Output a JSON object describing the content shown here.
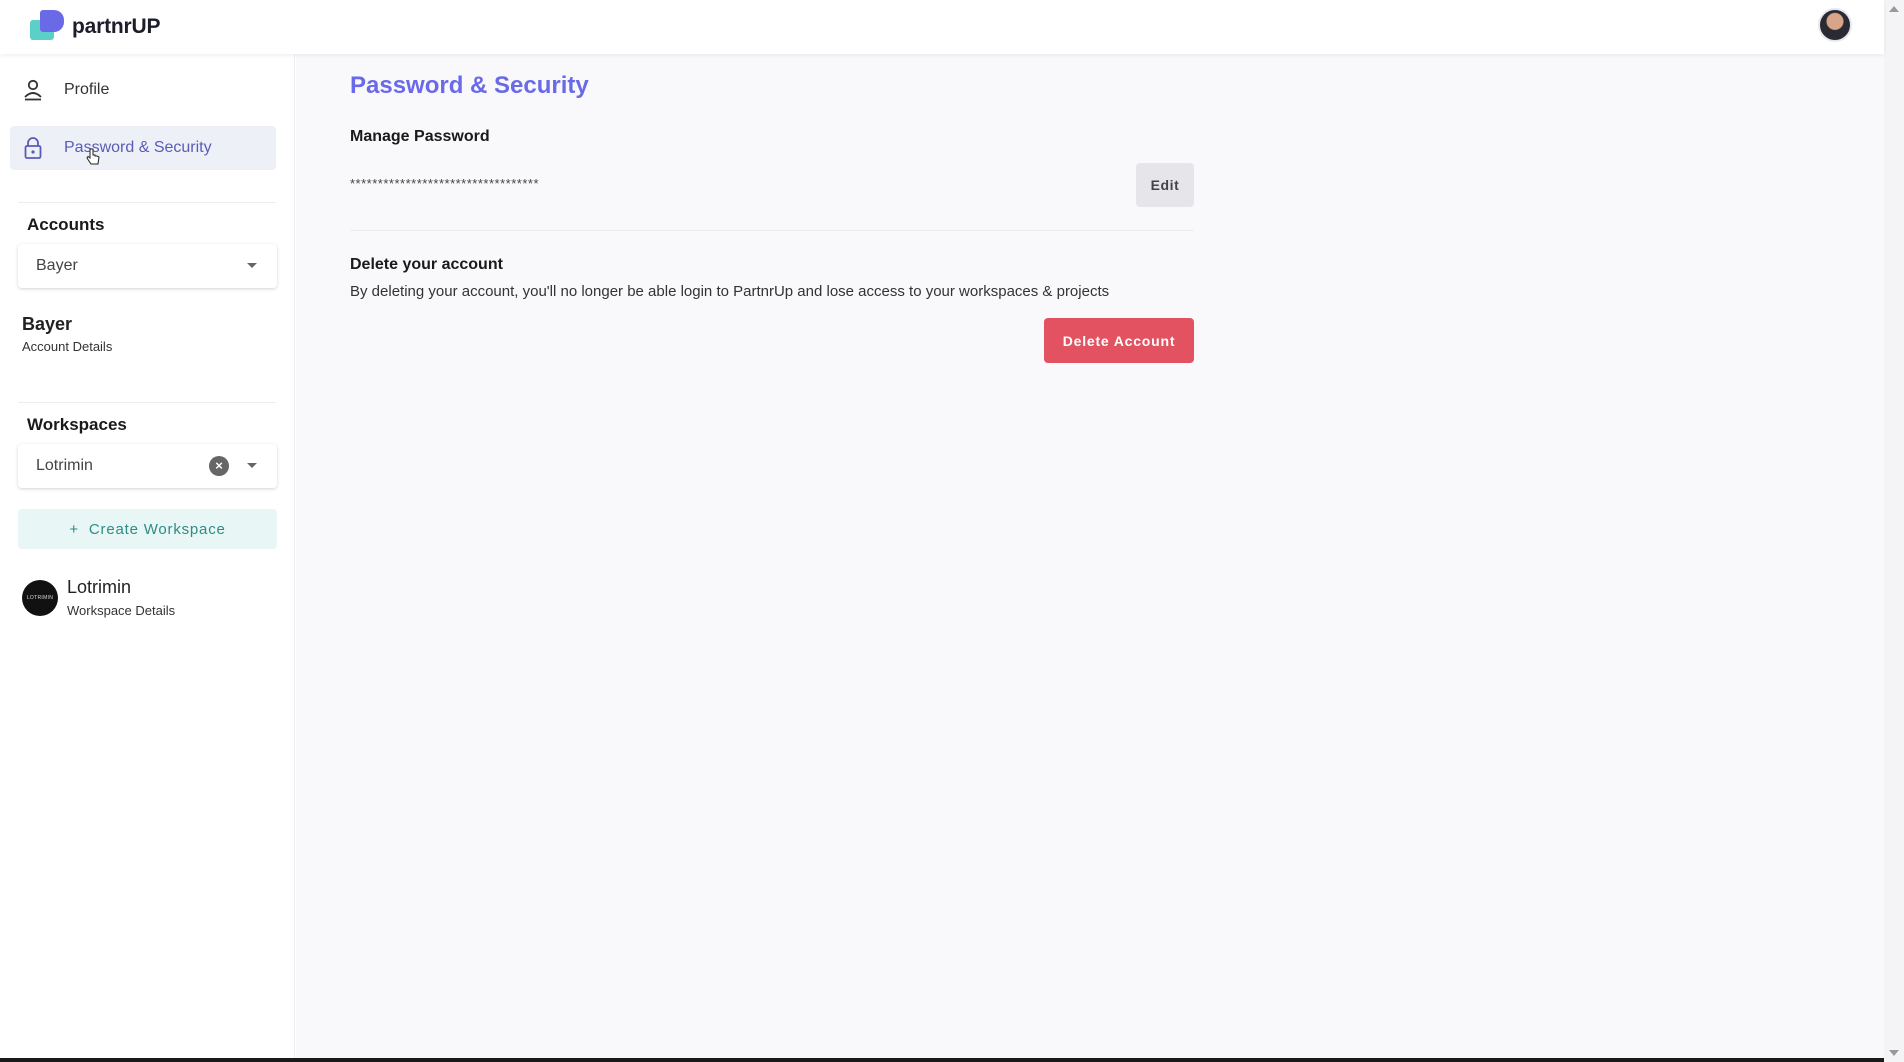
{
  "brand": {
    "name": "partnrUP"
  },
  "header": {
    "avatar_icon": "user-avatar"
  },
  "sidebar": {
    "nav": [
      {
        "label": "Profile",
        "icon": "person-icon"
      },
      {
        "label": "Password & Security",
        "icon": "lock-icon",
        "active": true
      }
    ],
    "accounts": {
      "title": "Accounts",
      "selected": "Bayer",
      "name": "Bayer",
      "details_link": "Account Details"
    },
    "workspaces": {
      "title": "Workspaces",
      "selected": "Lotrimin",
      "create_label": "Create Workspace",
      "name": "Lotrimin",
      "details_link": "Workspace Details",
      "logo_text": "LOTRIMIN"
    }
  },
  "main": {
    "title": "Password & Security",
    "manage_password": {
      "heading": "Manage Password",
      "masked": "**********************************",
      "edit_label": "Edit"
    },
    "delete_account": {
      "heading": "Delete your account",
      "description": "By deleting your account, you'll no longer be able login to PartnrUp and lose access to your workspaces & projects",
      "button_label": "Delete Account"
    }
  },
  "colors": {
    "accent": "#6a6ae8",
    "danger": "#e35260",
    "teal": "#2d8c85",
    "active_nav_bg": "#eef0f8"
  }
}
